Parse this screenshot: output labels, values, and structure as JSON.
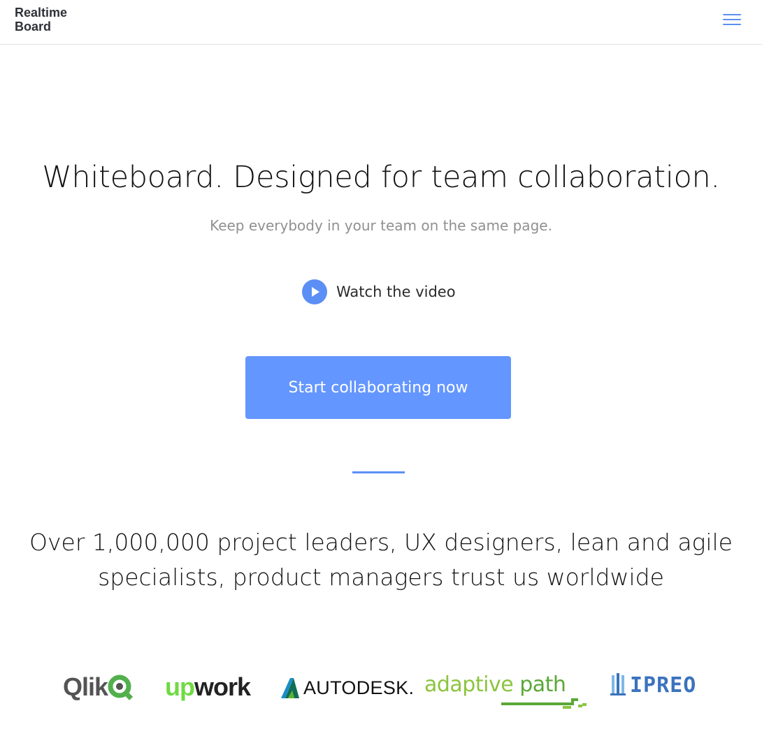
{
  "header": {
    "logo_line1": "Realtime",
    "logo_line2": "Board",
    "menu_icon": "hamburger-menu-icon"
  },
  "hero": {
    "title": "Whiteboard. Designed for team collaboration.",
    "subtitle": "Keep everybody in your team on the same page.",
    "video_label": "Watch the video",
    "video_icon": "play-icon",
    "cta_label": "Start collaborating now"
  },
  "trust": {
    "line1": "Over 1,000,000 project leaders, UX designers, lean and agile",
    "line2": "specialists, product managers trust us worldwide"
  },
  "clients": {
    "qlik": "Qlik",
    "upwork_up": "up",
    "upwork_work": "work",
    "autodesk": "AUTODESK.",
    "adaptive_part1": "adaptive",
    "adaptive_part2": "path",
    "ipreo": "IPREO"
  },
  "colors": {
    "accent": "#5c8ff5",
    "cta": "#6496ff",
    "subtitle": "#909090",
    "qlik_green": "#52b04c",
    "upwork_green": "#6fda44",
    "adaptive_green": "#8cc43f",
    "ipreo_blue": "#3b73bd"
  }
}
